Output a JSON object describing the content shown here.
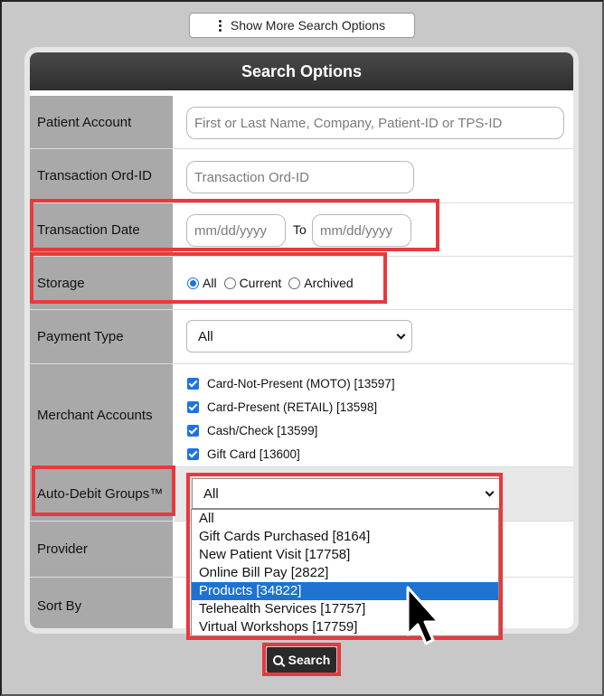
{
  "top_button": {
    "label": "Show More Search Options",
    "icon": "vertical-ellipsis-icon"
  },
  "panel": {
    "title": "Search Options"
  },
  "fields": {
    "patient_account": {
      "label": "Patient Account",
      "placeholder": "First or Last Name, Company, Patient-ID or TPS-ID"
    },
    "transaction_ord_id": {
      "label": "Transaction Ord-ID",
      "placeholder": "Transaction Ord-ID"
    },
    "transaction_date": {
      "label": "Transaction Date",
      "from_placeholder": "mm/dd/yyyy",
      "to_label": "To",
      "to_placeholder": "mm/dd/yyyy"
    },
    "storage": {
      "label": "Storage",
      "options": [
        "All",
        "Current",
        "Archived"
      ],
      "selected": "All"
    },
    "payment_type": {
      "label": "Payment Type",
      "value": "All"
    },
    "merchant_accounts": {
      "label": "Merchant Accounts",
      "items": [
        "Card-Not-Present (MOTO) [13597]",
        "Card-Present (RETAIL) [13598]",
        "Cash/Check [13599]",
        "Gift Card [13600]"
      ]
    },
    "auto_debit_groups": {
      "label": "Auto-Debit Groups™",
      "value": "All",
      "options": [
        "All",
        "Gift Cards Purchased [8164]",
        "New Patient Visit [17758]",
        "Online Bill Pay [2822]",
        "Products [34822]",
        "Telehealth Services [17757]",
        "Virtual Workshops [17759]"
      ],
      "highlighted": "Products [34822]"
    },
    "provider": {
      "label": "Provider"
    },
    "sort_by": {
      "label": "Sort By"
    }
  },
  "search_button": {
    "label": "Search",
    "icon": "search-icon"
  },
  "colors": {
    "header": "#3a3a3a",
    "label_bg": "#a9a9a9",
    "highlight": "#e8393e",
    "accent": "#1e73d2"
  }
}
